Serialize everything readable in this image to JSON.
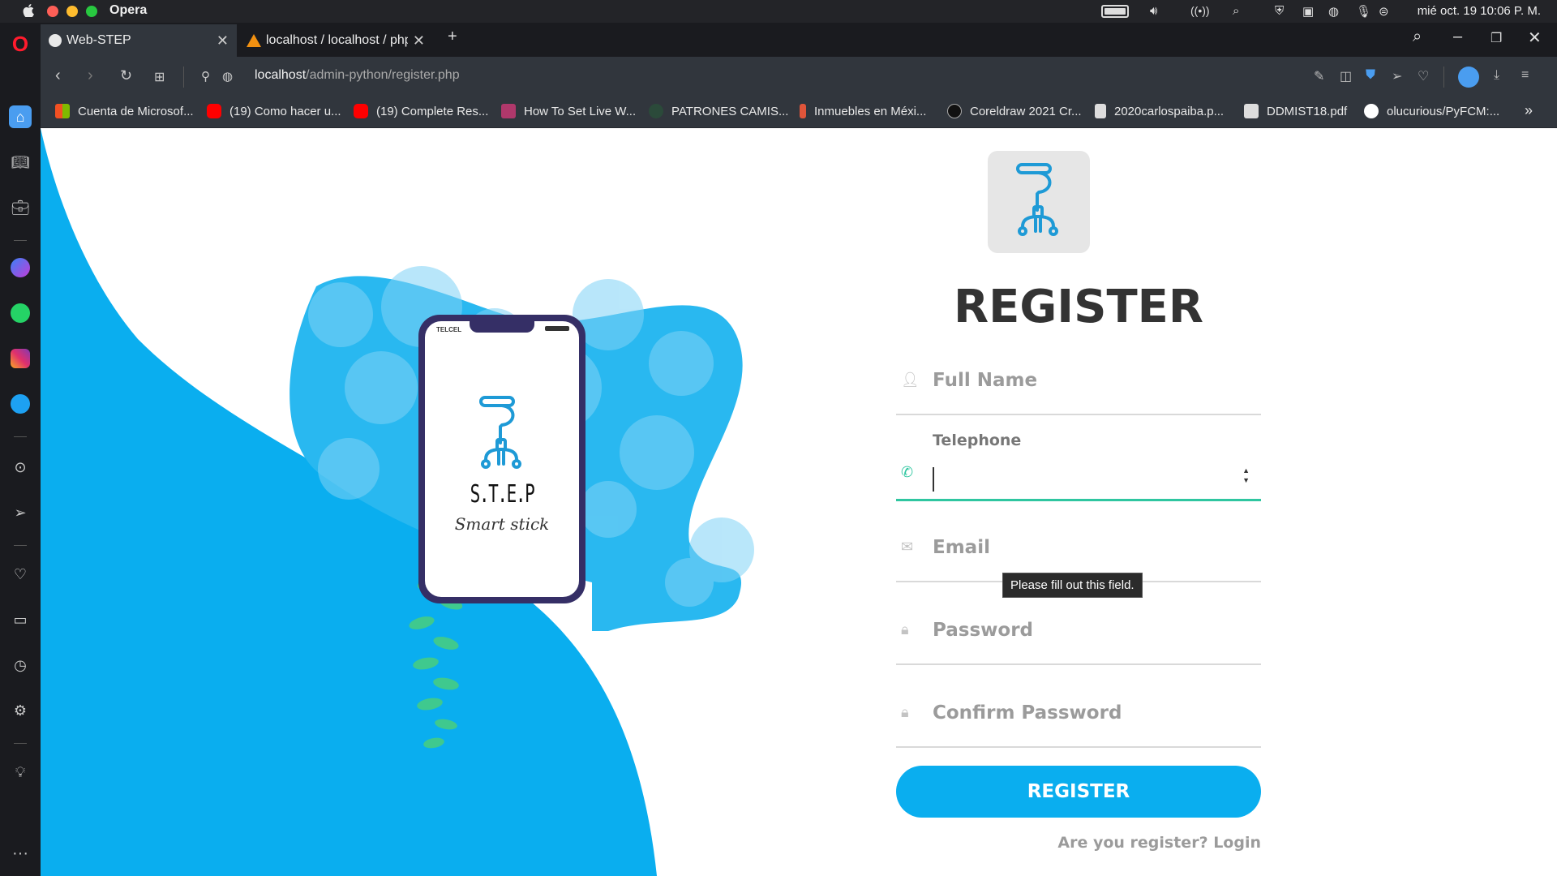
{
  "system": {
    "app_name": "Opera",
    "clock": "mié oct. 19  10:06 P. M."
  },
  "tabs": [
    {
      "title": "Web-STEP"
    },
    {
      "title": "localhost / localhost / php"
    }
  ],
  "address": {
    "host": "localhost",
    "path": "/admin-python/register.php"
  },
  "bookmarks": [
    {
      "label": "Cuenta de Microsof...",
      "icon": "microsoft-icon",
      "color": "#f25022"
    },
    {
      "label": "(19) Como hacer u...",
      "icon": "youtube-icon",
      "color": "#ff0000"
    },
    {
      "label": "(19) Complete Res...",
      "icon": "youtube-icon",
      "color": "#ff0000"
    },
    {
      "label": "How To Set Live W...",
      "icon": "site-icon",
      "color": "#b0386b"
    },
    {
      "label": "PATRONES CAMIS...",
      "icon": "site-icon",
      "color": "#2b4a3a"
    },
    {
      "label": "Inmuebles en Méxi...",
      "icon": "pin-icon",
      "color": "#e0553a"
    },
    {
      "label": "Coreldraw 2021 Cr...",
      "icon": "g-icon",
      "color": "#111111"
    },
    {
      "label": "2020carlospaiba.p...",
      "icon": "file-icon",
      "color": "#dddddd"
    },
    {
      "label": "DDMIST18.pdf",
      "icon": "d-icon",
      "color": "#dddddd"
    },
    {
      "label": "olucurious/PyFCM:...",
      "icon": "github-icon",
      "color": "#ffffff"
    }
  ],
  "illustration": {
    "carrier": "TELCEL",
    "brand": "S.T.E.P",
    "tagline": "Smart stick"
  },
  "form": {
    "heading": "REGISTER",
    "full_name_placeholder": "Full Name",
    "telephone_label": "Telephone",
    "email_placeholder": "Email",
    "password_placeholder": "Password",
    "confirm_password_placeholder": "Confirm Password",
    "submit_label": "REGISTER",
    "login_prompt": "Are you register? Login",
    "tooltip": "Please fill out this field.",
    "accent_color": "#0aaeef",
    "focus_color": "#2fc6a0"
  }
}
